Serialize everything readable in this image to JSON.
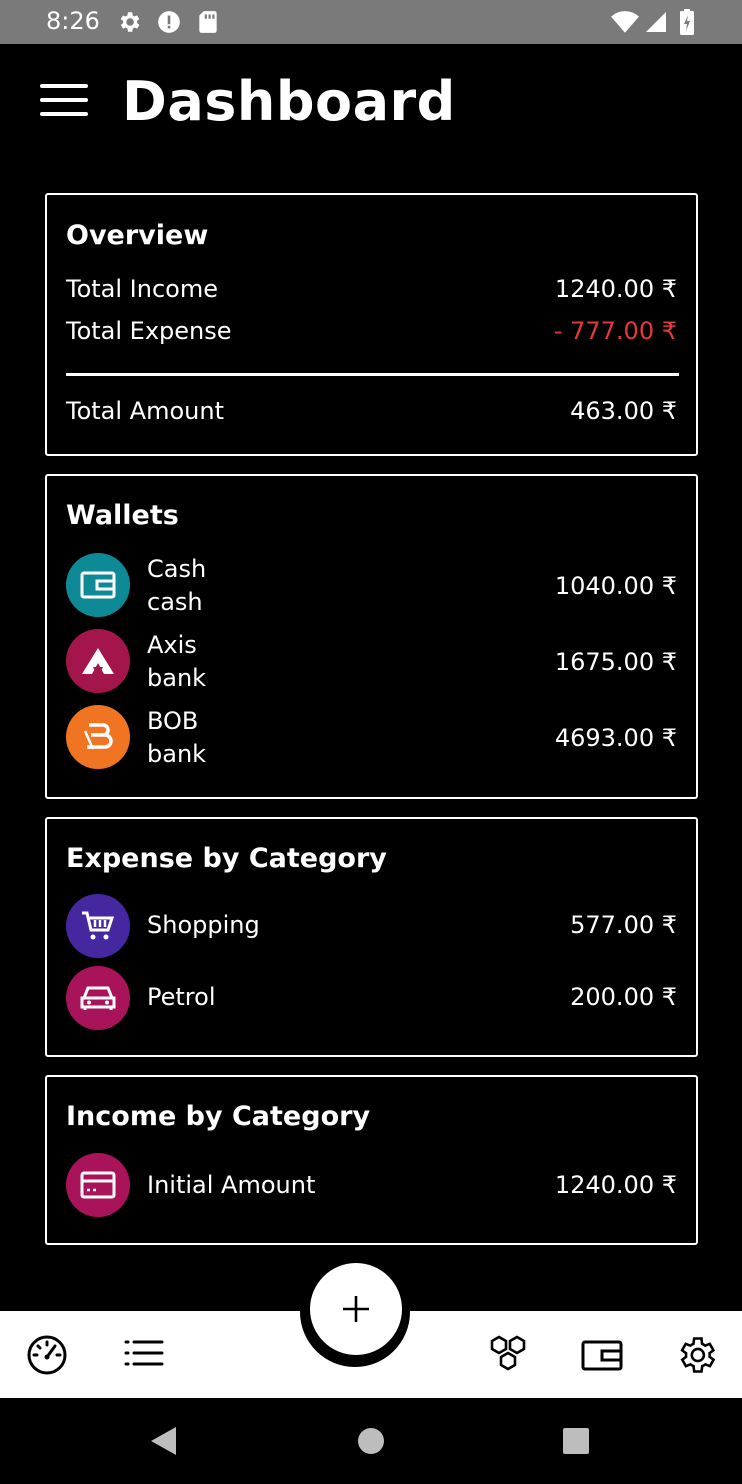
{
  "status_bar": {
    "time": "8:26",
    "icons": [
      "settings-icon",
      "alert-icon",
      "sd-card-icon",
      "wifi-icon",
      "signal-icon",
      "battery-icon"
    ]
  },
  "header": {
    "title": "Dashboard",
    "menu_icon": "menu-icon"
  },
  "overview": {
    "title": "Overview",
    "rows": [
      {
        "label": "Total Income",
        "value": "1240.00 ₹"
      },
      {
        "label": "Total Expense",
        "value": "- 777.00 ₹"
      }
    ],
    "total": {
      "label": "Total Amount",
      "value": "463.00 ₹"
    },
    "colors": {
      "negative": "#e5383b"
    }
  },
  "wallets": {
    "title": "Wallets",
    "items": [
      {
        "name": "Cash",
        "type": "cash",
        "value": "1040.00 ₹",
        "icon": "wallet-icon",
        "color": "#0d8a95"
      },
      {
        "name": "Axis",
        "type": "bank",
        "value": "1675.00 ₹",
        "icon": "axis-bank-icon",
        "color": "#a3154b"
      },
      {
        "name": "BOB",
        "type": "bank",
        "value": "4693.00 ₹",
        "icon": "bob-bank-icon",
        "color": "#f07522"
      }
    ]
  },
  "expense_by_category": {
    "title": "Expense by Category",
    "items": [
      {
        "name": "Shopping",
        "value": "577.00 ₹",
        "icon": "cart-icon",
        "color": "#4527a0"
      },
      {
        "name": "Petrol",
        "value": "200.00 ₹",
        "icon": "car-icon",
        "color": "#a9135a"
      }
    ]
  },
  "income_by_category": {
    "title": "Income by Category",
    "items": [
      {
        "name": "Initial Amount",
        "value": "1240.00 ₹",
        "icon": "card-icon",
        "color": "#a9135a"
      }
    ]
  },
  "bottom_nav": {
    "items": [
      "dashboard-gauge-icon",
      "list-icon",
      "categories-icon",
      "wallet-icon",
      "settings-icon"
    ],
    "fab_icon": "plus-icon"
  },
  "system_nav": [
    "back-icon",
    "home-icon",
    "recents-icon"
  ]
}
